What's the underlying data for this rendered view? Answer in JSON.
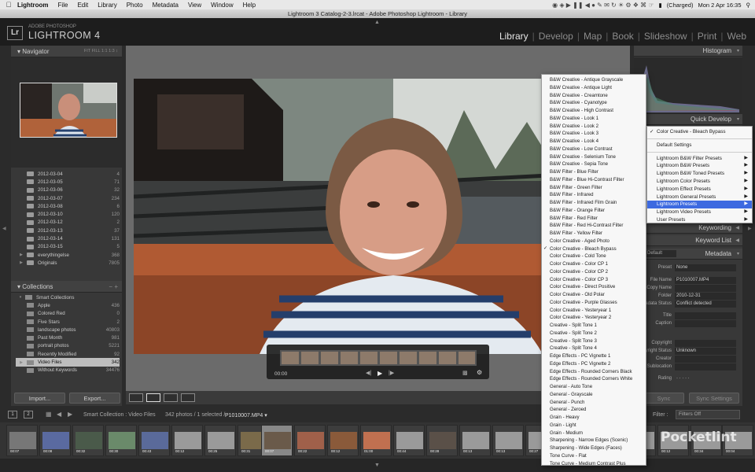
{
  "menubar": {
    "app_name": "Lightroom",
    "items": [
      "File",
      "Edit",
      "Library",
      "Photo",
      "Metadata",
      "View",
      "Window",
      "Help"
    ],
    "battery": "(Charged)",
    "clock": "Mon 2 Apr  16:35"
  },
  "window": {
    "title": "Lightroom 3 Catalog-2-3.lrcat - Adobe Photoshop Lightroom - Library"
  },
  "identity": {
    "badge": "Lr",
    "line1": "ADOBE PHOTOSHOP",
    "line2": "LIGHTROOM 4"
  },
  "modules": [
    "Library",
    "Develop",
    "Map",
    "Book",
    "Slideshow",
    "Print",
    "Web"
  ],
  "navigator": {
    "title": "Navigator",
    "zoom_options": "FIT   FILL   1:1   1:3 ↕"
  },
  "folders": [
    {
      "name": "2012-03-04",
      "count": "4"
    },
    {
      "name": "2012-03-05",
      "count": "71"
    },
    {
      "name": "2012-03-06",
      "count": "32"
    },
    {
      "name": "2012-03-07",
      "count": "234"
    },
    {
      "name": "2012-03-08",
      "count": "6"
    },
    {
      "name": "2012-03-10",
      "count": "120"
    },
    {
      "name": "2012-03-12",
      "count": "2"
    },
    {
      "name": "2012-03-13",
      "count": "37"
    },
    {
      "name": "2012-03-14",
      "count": "131"
    },
    {
      "name": "2012-03-15",
      "count": "5"
    },
    {
      "name": "everythingelse",
      "count": "368"
    },
    {
      "name": "Originals",
      "count": "7805"
    }
  ],
  "collections": {
    "title": "Collections",
    "actions": "−  +",
    "group": "Smart Collections",
    "items": [
      {
        "name": "Apple",
        "count": "436"
      },
      {
        "name": "Colored Red",
        "count": "0"
      },
      {
        "name": "Five Stars",
        "count": "2"
      },
      {
        "name": "landscape photos",
        "count": "40803"
      },
      {
        "name": "Past Month",
        "count": "981"
      },
      {
        "name": "portrait photos",
        "count": "5221"
      },
      {
        "name": "Recently Modified",
        "count": "92"
      },
      {
        "name": "Video Files",
        "count": "342"
      },
      {
        "name": "Without Keywords",
        "count": "34476"
      }
    ]
  },
  "buttons": {
    "import": "Import...",
    "export": "Export...",
    "sync": "Sync",
    "sync_settings": "Sync Settings"
  },
  "video": {
    "time": "00:00"
  },
  "right_panel": {
    "histogram": "Histogram",
    "quick_develop": "Quick Develop",
    "keywording": "Keywording",
    "keyword_list": "Keyword List",
    "metadata": "Metadata",
    "metadata_preset_label": "Default",
    "preset_label": "Preset",
    "preset_value": "None",
    "fields": [
      {
        "label": "File Name",
        "value": "P1010007.MP4"
      },
      {
        "label": "Copy Name",
        "value": ""
      },
      {
        "label": "Folder",
        "value": "2010-12-31"
      },
      {
        "label": "Metadata Status",
        "value": "Conflict detected"
      },
      {
        "label": "Title",
        "value": ""
      },
      {
        "label": "Caption",
        "value": ""
      },
      {
        "label": "Copyright",
        "value": ""
      },
      {
        "label": "Copyright Status",
        "value": "Unknown"
      },
      {
        "label": "Creator",
        "value": ""
      },
      {
        "label": "Sublocation",
        "value": ""
      },
      {
        "label": "Rating",
        "value": "·  ·  ·  ·  ·"
      }
    ]
  },
  "filmstrip": {
    "page1": "1",
    "page2": "2",
    "source": "Smart Collection : Video Files",
    "count": "342 photos / 1 selected /",
    "filename": "P1010007.MP4 ▾",
    "filter_label": "Filter :",
    "filter_value": "Filters Off",
    "durations": [
      "00:07",
      "00:08",
      "00:32",
      "00:30",
      "00:43",
      "00:12",
      "00:25",
      "00:31",
      "00:07",
      "00:22",
      "00:12",
      "01:00",
      "00:44",
      "00:28",
      "00:13",
      "00:13",
      "00:27",
      "00:18",
      "00:12",
      "00:12",
      "00:12",
      "00:34",
      "00:04"
    ]
  },
  "watermark": "Pocketlint",
  "presets_menu": {
    "checked_index": 22,
    "items": [
      "B&W Creative - Antique Grayscale",
      "B&W Creative - Antique Light",
      "B&W Creative - Creamtone",
      "B&W Creative - Cyanotype",
      "B&W Creative - High Contrast",
      "B&W Creative - Look 1",
      "B&W Creative - Look 2",
      "B&W Creative - Look 3",
      "B&W Creative - Look 4",
      "B&W Creative - Low Contrast",
      "B&W Creative - Selenium Tone",
      "B&W Creative - Sepia Tone",
      "B&W Filter - Blue Filter",
      "B&W Filter - Blue Hi-Contrast Filter",
      "B&W Filter - Green Filter",
      "B&W Filter - Infrared",
      "B&W Filter - Infrared Film Grain",
      "B&W Filter - Orange Filter",
      "B&W Filter - Red Filter",
      "B&W Filter - Red Hi-Contrast Filter",
      "B&W Filter - Yellow Filter",
      "Color Creative - Aged Photo",
      "Color Creative - Bleach Bypass",
      "Color Creative - Cold Tone",
      "Color Creative - Color CP 1",
      "Color Creative - Color CP 2",
      "Color Creative - Color CP 3",
      "Color Creative - Direct Positive",
      "Color Creative - Old Polar",
      "Color Creative - Purple Glasses",
      "Color Creative - Yesteryear 1",
      "Color Creative - Yesteryear 2",
      "Creative - Split Tone 1",
      "Creative - Split Tone 2",
      "Creative - Split Tone 3",
      "Creative - Split Tone 4",
      "Edge Effects - PC Vignette 1",
      "Edge Effects - PC Vignette 2",
      "Edge Effects - Rounded Corners Black",
      "Edge Effects - Rounded Corners White",
      "General - Auto Tone",
      "General - Grayscale",
      "General - Punch",
      "General - Zeroed",
      "Grain - Heavy",
      "Grain - Light",
      "Grain - Medium",
      "Sharpening - Narrow Edges (Scenic)",
      "Sharpening - Wide Edges (Faces)",
      "Tone Curve - Flat",
      "Tone Curve - Medium Contrast Plus"
    ]
  },
  "sub_menu": {
    "current": "Color Creative - Bleach Bypass",
    "default": "Default Settings",
    "items": [
      "Lightroom B&W Filter Presets",
      "Lightroom B&W Presets",
      "Lightroom B&W Toned Presets",
      "Lightroom Color Presets",
      "Lightroom Effect Presets",
      "Lightroom General Presets",
      "Lightroom Presets",
      "Lightroom Video Presets",
      "User Presets"
    ],
    "highlight_index": 6
  },
  "colors": {
    "menu_highlight": "#3d6ae0",
    "panel_bg": "#383838",
    "center_bg": "#6b6b6b"
  }
}
